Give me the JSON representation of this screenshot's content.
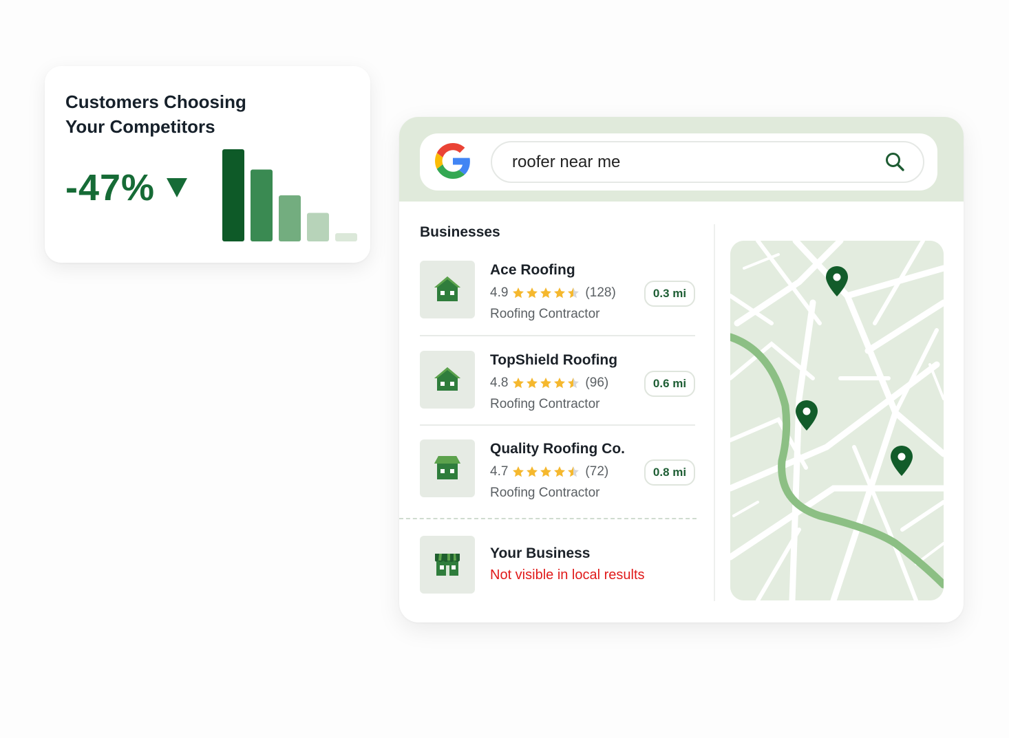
{
  "stat_card": {
    "title": "Customers Choosing Your Competitors",
    "value": "-47%",
    "trend_icon": "down-triangle-icon",
    "bar_levels": [
      1.0,
      0.78,
      0.5,
      0.31,
      0.09
    ],
    "bar_colors": [
      "#0e5a28",
      "#3a8a52",
      "#73ad7f",
      "#b7d3b9",
      "#dbe8d9"
    ]
  },
  "search": {
    "logo": "google-g-icon",
    "query": "roofer near me",
    "icon": "search-icon"
  },
  "businesses": {
    "title": "Businesses",
    "listings": [
      {
        "name": "Ace Roofing",
        "rating": "4.9",
        "stars": 4.5,
        "reviews": "(128)",
        "category": "Roofing Contractor",
        "distance": "0.3 mi",
        "icon": "house-icon"
      },
      {
        "name": "TopShield Roofing",
        "rating": "4.8",
        "stars": 4.5,
        "reviews": "(96)",
        "category": "Roofing Contractor",
        "distance": "0.6 mi",
        "icon": "house-icon"
      },
      {
        "name": "Quality Roofing Co.",
        "rating": "4.7",
        "stars": 4.5,
        "reviews": "(72)",
        "category": "Roofing Contractor",
        "distance": "0.8 mi",
        "icon": "shop-icon"
      }
    ],
    "your_business": {
      "name": "Your Business",
      "status": "Not visible in local results",
      "icon": "storefront-icon"
    }
  },
  "map": {
    "pins": 3,
    "pin_icon": "map-pin-icon"
  },
  "colors": {
    "brand_green": "#166b36",
    "header_tint": "#e0eadb",
    "star": "#f5b82e",
    "warning_red": "#e01a1a"
  }
}
